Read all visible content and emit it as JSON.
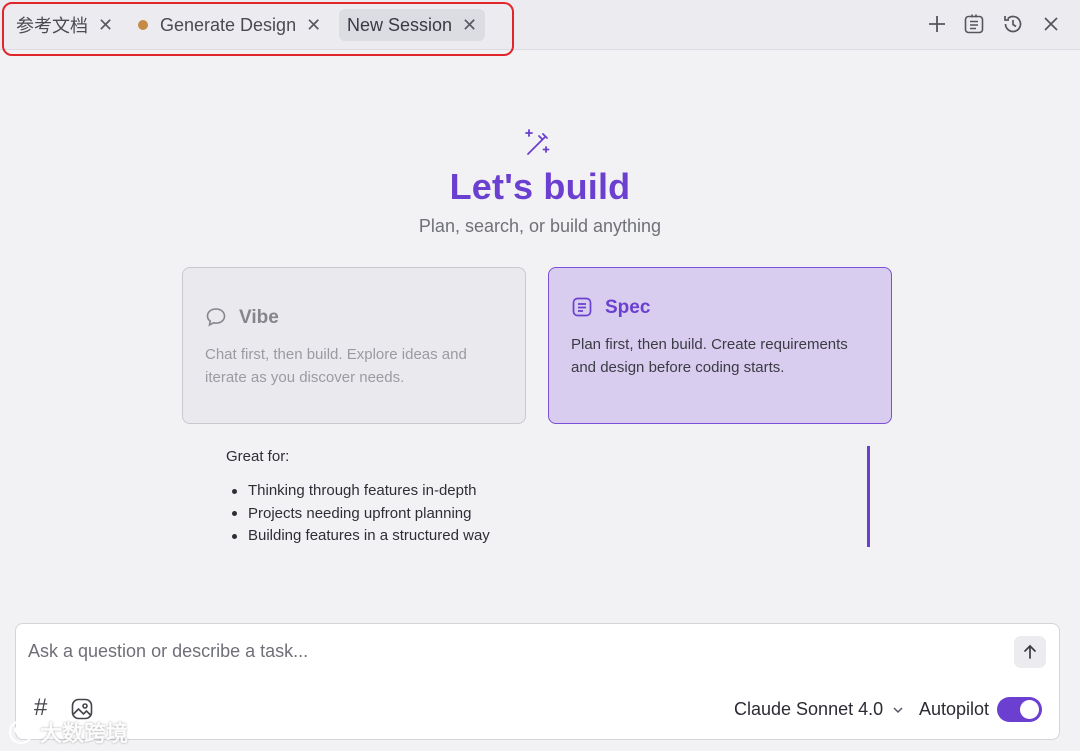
{
  "tabs": [
    {
      "label": "参考文档",
      "close": "✕",
      "active": false,
      "modified": false
    },
    {
      "label": "Generate Design",
      "close": "✕",
      "active": false,
      "modified": true
    },
    {
      "label": "New Session",
      "close": "✕",
      "active": true,
      "modified": false
    }
  ],
  "toolbar_icons": [
    "plus-icon",
    "task-list-icon",
    "history-icon",
    "close-icon"
  ],
  "hero": {
    "icon": "magic-wand-icon",
    "title": "Let's build",
    "subtitle": "Plan, search, or build anything"
  },
  "modes": {
    "vibe": {
      "icon": "chat-bubble-icon",
      "title": "Vibe",
      "description": "Chat first, then build. Explore ideas and iterate as you discover needs.",
      "selected": false
    },
    "spec": {
      "icon": "document-list-icon",
      "title": "Spec",
      "description": "Plan first, then build. Create requirements and design before coding starts.",
      "selected": true
    }
  },
  "great_for": {
    "title": "Great for:",
    "items": [
      "Thinking through features in-depth",
      "Projects needing upfront planning",
      "Building features in a structured way"
    ]
  },
  "composer": {
    "placeholder": "Ask a question or describe a task...",
    "value": "",
    "hash_label": "#",
    "model": "Claude Sonnet 4.0",
    "autopilot_label": "Autopilot",
    "autopilot_on": true
  },
  "colors": {
    "accent": "#6b3fcf",
    "spec_card_bg": "#d9cdef",
    "modified_dot": "#c58a45",
    "highlight": "#e0262a"
  },
  "watermark": "大数跨境"
}
